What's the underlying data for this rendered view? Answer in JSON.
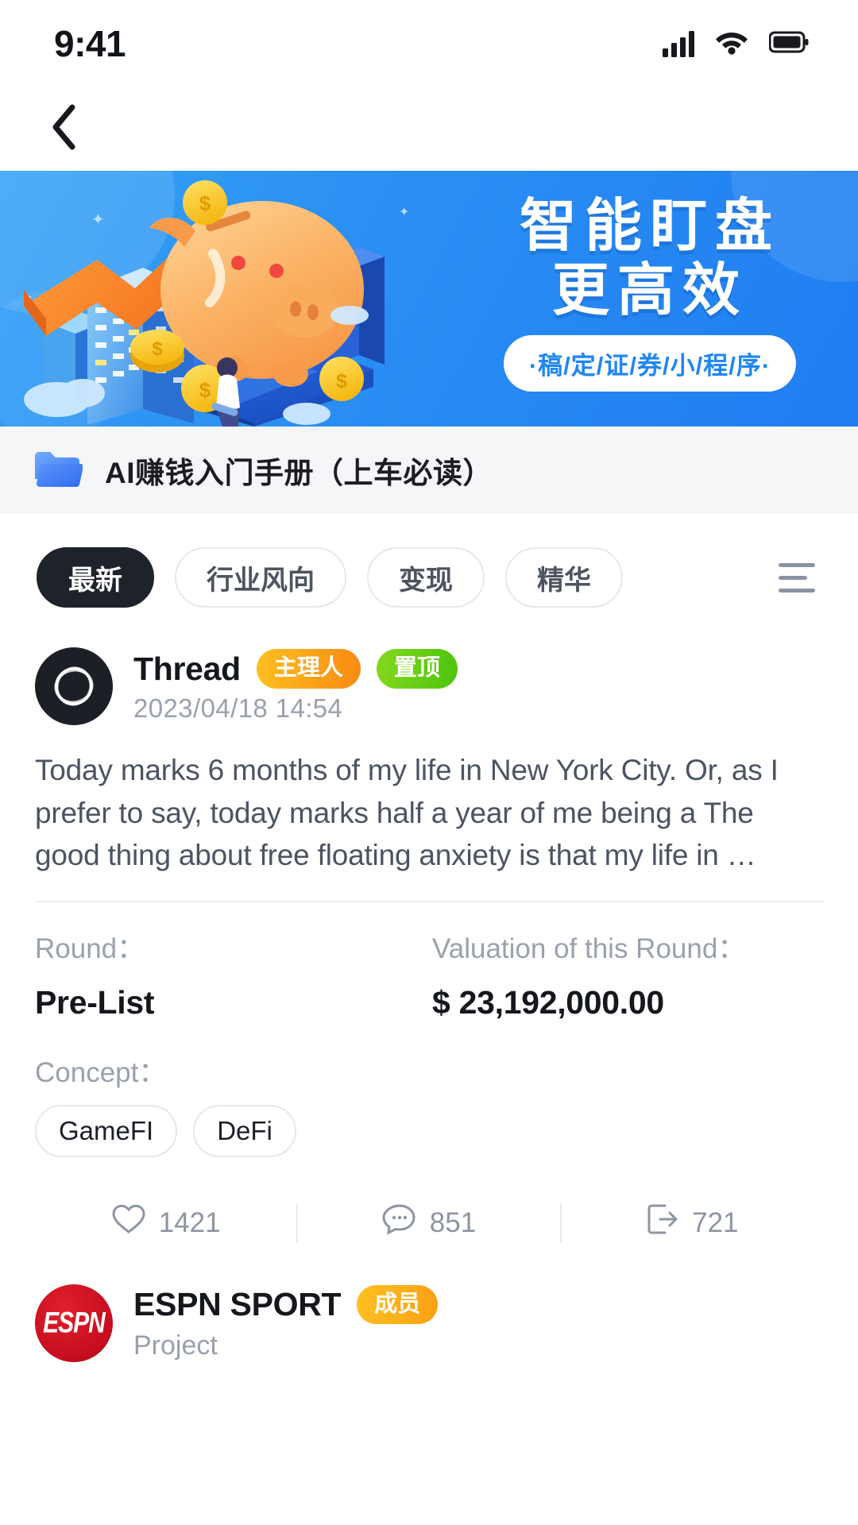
{
  "status_bar": {
    "time": "9:41",
    "signal_icon": "cellular-signal-icon",
    "wifi_icon": "wifi-icon",
    "battery_icon": "battery-icon"
  },
  "nav": {
    "back_icon": "back-chevron-icon"
  },
  "banner": {
    "line1": "智能盯盘",
    "line2": "更高效",
    "pill": "·稿/定/证/券/小/程/序·",
    "bg_color": "#2b90f4",
    "pill_text_color": "#1f86f5",
    "art_icon": "piggy-bank-growth-illustration"
  },
  "folder": {
    "icon": "folder-icon",
    "title": "AI赚钱入门手册（上车必读）"
  },
  "filters": {
    "chips": [
      {
        "label": "最新",
        "active": true
      },
      {
        "label": "行业风向",
        "active": false
      },
      {
        "label": "变现",
        "active": false
      },
      {
        "label": "精华",
        "active": false
      }
    ],
    "menu_icon": "hamburger-menu-icon"
  },
  "post": {
    "avatar_icon": "threads-logo-avatar",
    "author": "Thread",
    "badges": [
      {
        "label": "主理人",
        "color": "#f78a12"
      },
      {
        "label": "置顶",
        "color": "#4cc40c"
      }
    ],
    "timestamp": "2023/04/18  14:54",
    "body": "Today marks 6 months of my life in New York City. Or, as I prefer to say, today marks half a year of me being a The good thing about free floating anxiety is that my life in …",
    "meta": {
      "round_label": "Round：",
      "round_value": "Pre-List",
      "valuation_label": "Valuation of this Round：",
      "valuation_value": "$ 23,192,000.00",
      "concept_label": "Concept：",
      "concept_tags": [
        "GameFI",
        "DeFi"
      ]
    },
    "actions": [
      {
        "icon": "heart-icon",
        "count": "1421"
      },
      {
        "icon": "comment-icon",
        "count": "851"
      },
      {
        "icon": "share-icon",
        "count": "721"
      }
    ]
  },
  "post2": {
    "avatar_icon": "espn-logo-avatar",
    "avatar_text": "ESPN",
    "author": "ESPN SPORT",
    "badge": {
      "label": "成员",
      "color": "#f9a014"
    },
    "subtitle": "Project"
  }
}
